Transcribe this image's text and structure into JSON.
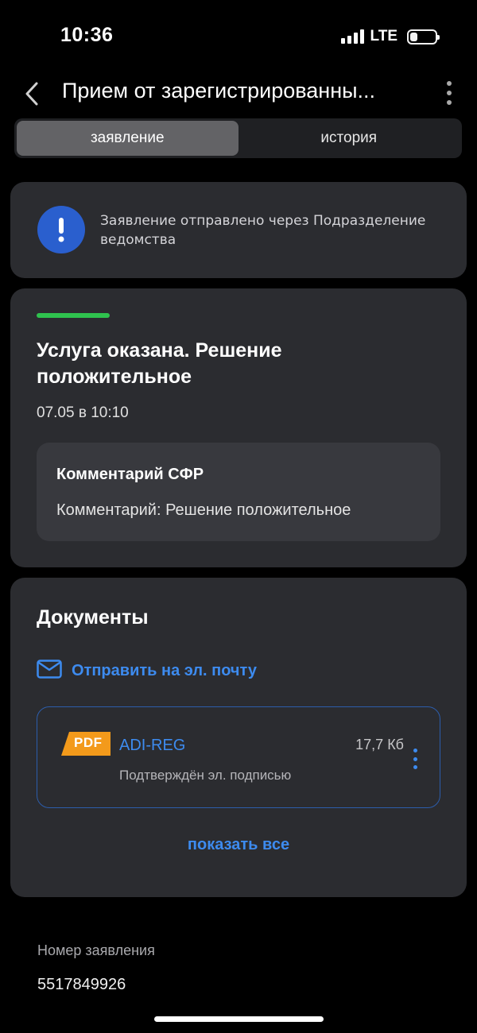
{
  "status_bar": {
    "time": "10:36",
    "network": "LTE",
    "icons": [
      "signal-icon",
      "battery-icon"
    ]
  },
  "nav": {
    "title": "Прием от зарегистрированны...",
    "back_icon": "chevron-left-icon",
    "menu_icon": "more-vertical-icon"
  },
  "tabs": [
    {
      "label": "заявление",
      "active": true
    },
    {
      "label": "история",
      "active": false
    }
  ],
  "info": {
    "icon": "exclamation-icon",
    "text": "Заявление отправлено через Подразделение ведомства",
    "color": "#2a5fce"
  },
  "status": {
    "indicator_color": "#2fc24e",
    "title": "Услуга оказана. Решение положительное",
    "date": "07.05 в 10:10",
    "comment": {
      "heading": "Комментарий СФР",
      "body": "Комментарий: Решение положительное"
    }
  },
  "documents": {
    "title": "Документы",
    "send_mail_label": "Отправить на эл. почту",
    "send_mail_icon": "envelope-icon",
    "items": [
      {
        "badge": "PDF",
        "name": "ADI-REG",
        "size": "17,7 Кб",
        "subtitle": "Подтверждён эл. подписью",
        "badge_color": "#f39a1b"
      }
    ],
    "show_all_label": "показать все",
    "accent_color": "#3d8bef"
  },
  "application": {
    "label": "Номер заявления",
    "number": "5517849926"
  }
}
